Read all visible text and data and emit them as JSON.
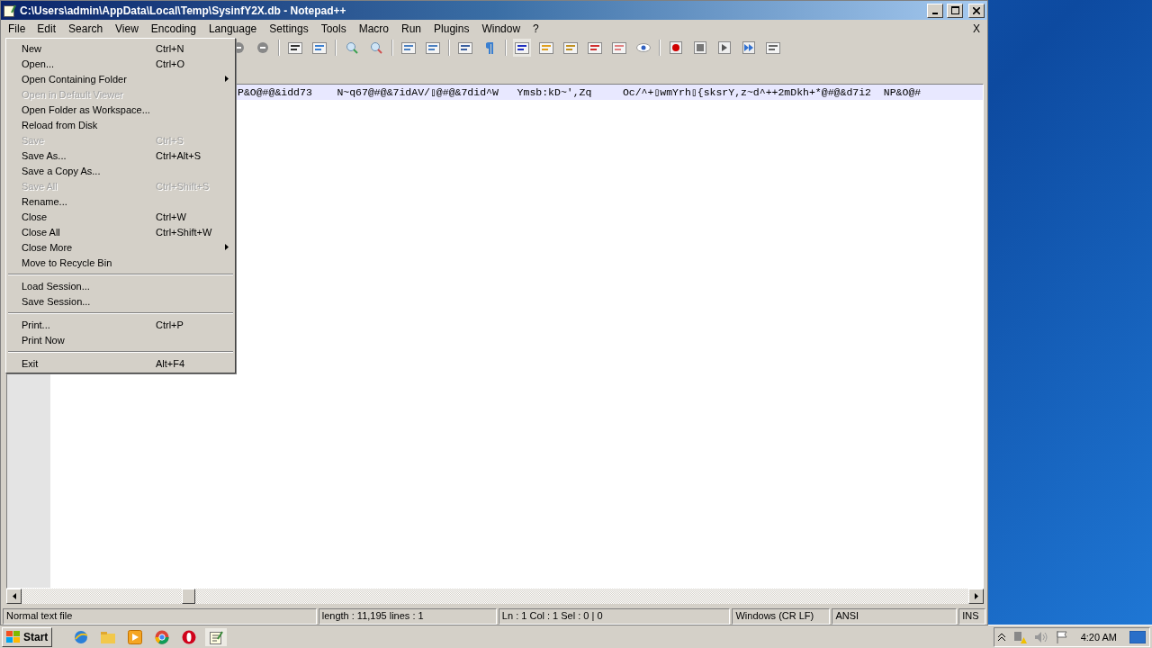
{
  "window": {
    "title": "C:\\Users\\admin\\AppData\\Local\\Temp\\SysinfY2X.db - Notepad++"
  },
  "menu_bar": [
    {
      "label": "File",
      "selected": true
    },
    {
      "label": "Edit",
      "selected": false
    },
    {
      "label": "Search",
      "selected": false
    },
    {
      "label": "View",
      "selected": false
    },
    {
      "label": "Encoding",
      "selected": false
    },
    {
      "label": "Language",
      "selected": false
    },
    {
      "label": "Settings",
      "selected": false
    },
    {
      "label": "Tools",
      "selected": false
    },
    {
      "label": "Macro",
      "selected": false
    },
    {
      "label": "Run",
      "selected": false
    },
    {
      "label": "Plugins",
      "selected": false
    },
    {
      "label": "Window",
      "selected": false
    },
    {
      "label": "?",
      "selected": false
    }
  ],
  "close_document": "X",
  "toolbar": [
    {
      "pressed": false
    },
    {
      "pressed": false
    },
    {
      "pressed": false
    },
    {
      "pressed": false
    },
    {
      "pressed": false
    },
    {
      "pressed": false
    },
    {
      "pressed": false
    },
    {
      "pressed": false
    },
    {
      "pressed": false
    },
    {
      "pressed": false
    },
    {
      "pressed": true
    },
    {
      "pressed": false
    },
    {
      "pressed": false
    },
    {
      "pressed": false
    },
    {
      "pressed": false
    },
    {
      "pressed": false
    },
    {
      "pressed": false
    },
    {
      "pressed": false
    },
    {
      "pressed": false
    },
    {
      "pressed": false
    },
    {
      "pressed": false
    }
  ],
  "file_menu": [
    {
      "kind": "item",
      "label": "New",
      "shortcut": "Ctrl+N",
      "disabled": false,
      "submenu": false
    },
    {
      "kind": "item",
      "label": "Open...",
      "shortcut": "Ctrl+O",
      "disabled": false,
      "submenu": false
    },
    {
      "kind": "item",
      "label": "Open Containing Folder",
      "disabled": false,
      "submenu": true
    },
    {
      "kind": "item",
      "label": "Open in Default Viewer",
      "disabled": true,
      "submenu": false
    },
    {
      "kind": "item",
      "label": "Open Folder as Workspace...",
      "disabled": false,
      "submenu": false
    },
    {
      "kind": "item",
      "label": "Reload from Disk",
      "disabled": false,
      "submenu": false
    },
    {
      "kind": "item",
      "label": "Save",
      "shortcut": "Ctrl+S",
      "disabled": true,
      "submenu": false
    },
    {
      "kind": "item",
      "label": "Save As...",
      "shortcut": "Ctrl+Alt+S",
      "disabled": false,
      "submenu": false
    },
    {
      "kind": "item",
      "label": "Save a Copy As...",
      "disabled": false,
      "submenu": false
    },
    {
      "kind": "item",
      "label": "Save All",
      "shortcut": "Ctrl+Shift+S",
      "disabled": true,
      "submenu": false
    },
    {
      "kind": "item",
      "label": "Rename...",
      "disabled": false,
      "submenu": false
    },
    {
      "kind": "item",
      "label": "Close",
      "shortcut": "Ctrl+W",
      "disabled": false,
      "submenu": false
    },
    {
      "kind": "item",
      "label": "Close All",
      "shortcut": "Ctrl+Shift+W",
      "disabled": false,
      "submenu": false
    },
    {
      "kind": "item",
      "label": "Close More",
      "disabled": false,
      "submenu": true
    },
    {
      "kind": "item",
      "label": "Move to Recycle Bin",
      "disabled": false,
      "submenu": false
    },
    {
      "kind": "separator"
    },
    {
      "kind": "item",
      "label": "Load Session...",
      "disabled": false,
      "submenu": false
    },
    {
      "kind": "item",
      "label": "Save Session...",
      "disabled": false,
      "submenu": false
    },
    {
      "kind": "separator"
    },
    {
      "kind": "item",
      "label": "Print...",
      "shortcut": "Ctrl+P",
      "disabled": false,
      "submenu": false
    },
    {
      "kind": "item",
      "label": "Print Now",
      "disabled": false,
      "submenu": false
    },
    {
      "kind": "separator"
    },
    {
      "kind": "item",
      "label": "Exit",
      "shortcut": "Alt+F4",
      "disabled": false,
      "submenu": false
    }
  ],
  "editor": {
    "line": "P&O@#@&idd73    N~q67@#@&7idAV/▯@#@&7did^W   Ymsb:kD~',Zq     Oc/^+▯wmYrh▯{sksrY,z~d^++2mDkh+*@#@&d7i2  NP&O@#"
  },
  "status_bar": [
    "Normal text file",
    "length : 11,195    lines : 1",
    "Ln : 1    Col : 1    Sel : 0 | 0",
    "Windows (CR LF)",
    "ANSI",
    "INS"
  ],
  "taskbar": {
    "start": "Start",
    "apps": [
      {
        "selected": false
      },
      {
        "selected": false
      },
      {
        "selected": false
      },
      {
        "selected": false
      },
      {
        "selected": false
      },
      {
        "selected": true
      }
    ],
    "clock": "4:20 AM"
  }
}
